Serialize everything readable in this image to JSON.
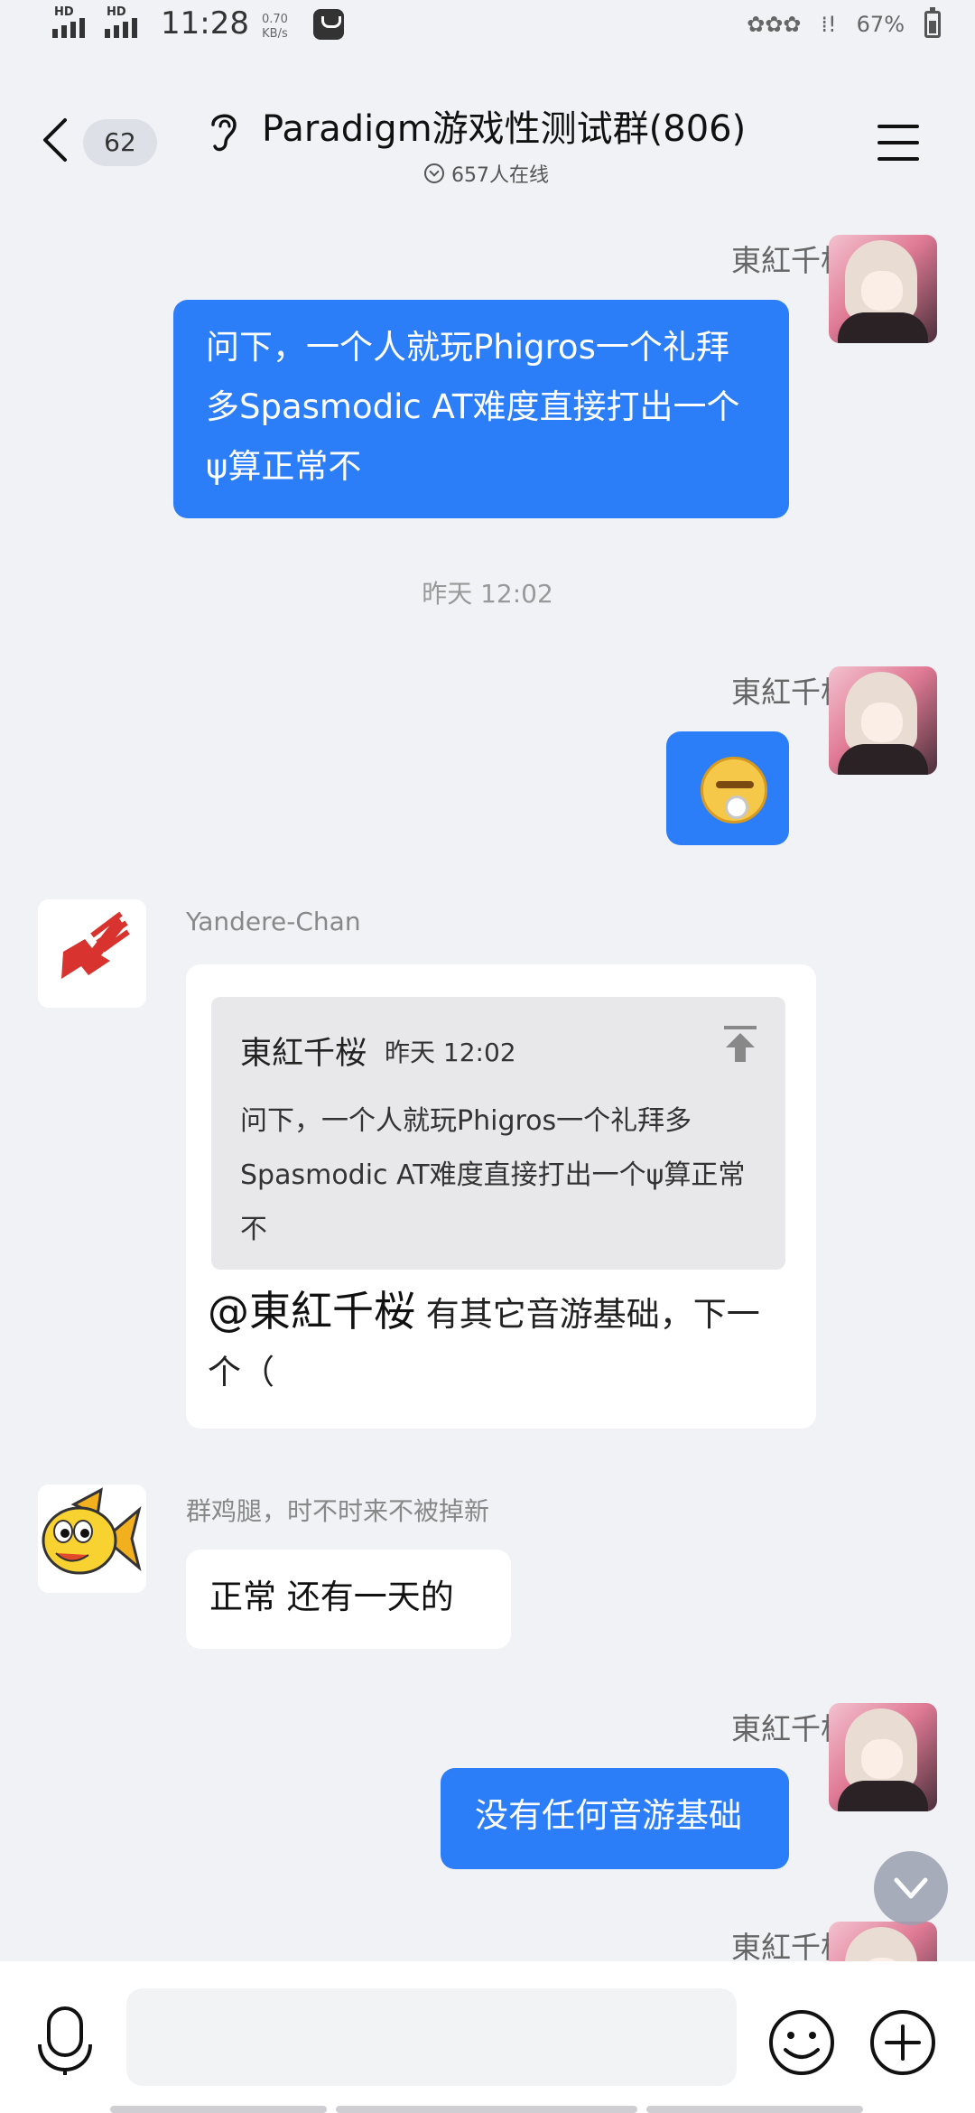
{
  "status_bar": {
    "sim1": "HD",
    "sim2": "HD",
    "time": "11:28",
    "speed_value": "0.70",
    "speed_unit": "KB/s",
    "battery": "67%"
  },
  "header": {
    "unread_count": "62",
    "title": "Paradigm游戏性测试群(806)",
    "online": "657人在线"
  },
  "messages": [
    {
      "sender": "東紅千桜",
      "text": "问下，一个人就玩Phigros一个礼拜多Spasmodic AT难度直接打出一个ψ算正常不"
    },
    {
      "timestamp": "昨天 12:02"
    },
    {
      "sender": "東紅千桜",
      "sticker": "sticker-emoji"
    },
    {
      "sender": "Yandere-Chan",
      "quote": {
        "sender": "東紅千桜",
        "time": "昨天 12:02",
        "text": "问下，一个人就玩Phigros一个礼拜多Spasmodic AT难度直接打出一个ψ算正常不"
      },
      "mention": "@東紅千桜",
      "text": " 有其它音游基础，下一个（"
    },
    {
      "sender": "群鸡腿，时不时来不被掉新",
      "text": "正常 还有一天的"
    },
    {
      "sender": "東紅千桜",
      "text": "没有任何音游基础"
    },
    {
      "sender": "東紅千桜"
    }
  ],
  "input": {
    "placeholder": ""
  },
  "colors": {
    "background": "#f1f2f6",
    "bubble_self": "#2c7ef8",
    "bubble_other": "#ffffff"
  }
}
